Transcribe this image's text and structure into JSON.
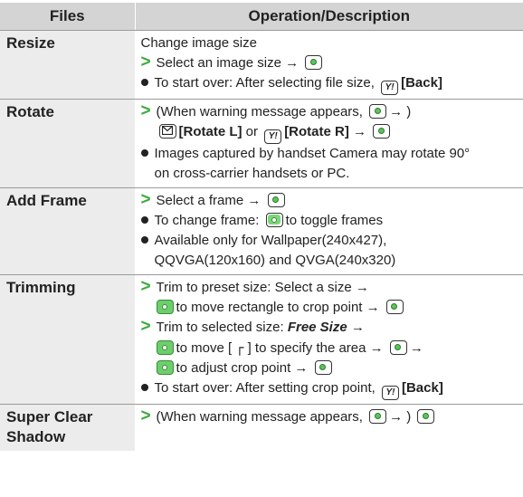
{
  "header": {
    "files": "Files",
    "operation": "Operation/Description"
  },
  "rows": [
    {
      "name": "Resize",
      "lines": [
        {
          "t": "Change image size"
        },
        {
          "t": "Select an image size →"
        },
        {
          "t": "To start over: After selecting file size,",
          "b": "[Back]"
        }
      ]
    },
    {
      "name": "Rotate",
      "lines": [
        {
          "a": "(When warning message appears,",
          "c": "→ )"
        },
        {
          "b1": "[Rotate L]",
          "or": "or",
          "b2": "[Rotate R]",
          "arrow": "→"
        },
        {
          "t": "Images captured by handset Camera may rotate 90°"
        },
        {
          "t": "on cross-carrier handsets or PC."
        }
      ]
    },
    {
      "name": "Add Frame",
      "lines": [
        {
          "t": "Select a frame →"
        },
        {
          "a": "To change frame:",
          "c": "to toggle frames"
        },
        {
          "t": "Available only for Wallpaper(240x427),"
        },
        {
          "t": "QQVGA(120x160) and QVGA(240x320)"
        }
      ]
    },
    {
      "name": "Trimming",
      "lines": [
        {
          "t": "Trim to preset size: Select a size →"
        },
        {
          "t": "to move rectangle to crop point →"
        },
        {
          "a": "Trim to selected size:",
          "b": "Free Size",
          "c": "→"
        },
        {
          "a": "to move [",
          "mark": "┌",
          "c": "] to specify the area →",
          "d": "→"
        },
        {
          "t": "to adjust crop point →"
        },
        {
          "t": "To start over: After setting crop point,",
          "b": "[Back]"
        }
      ]
    },
    {
      "name": "Super Clear Shadow",
      "lines": [
        {
          "a": "(When warning message appears,",
          "c": "→ )"
        }
      ]
    }
  ]
}
